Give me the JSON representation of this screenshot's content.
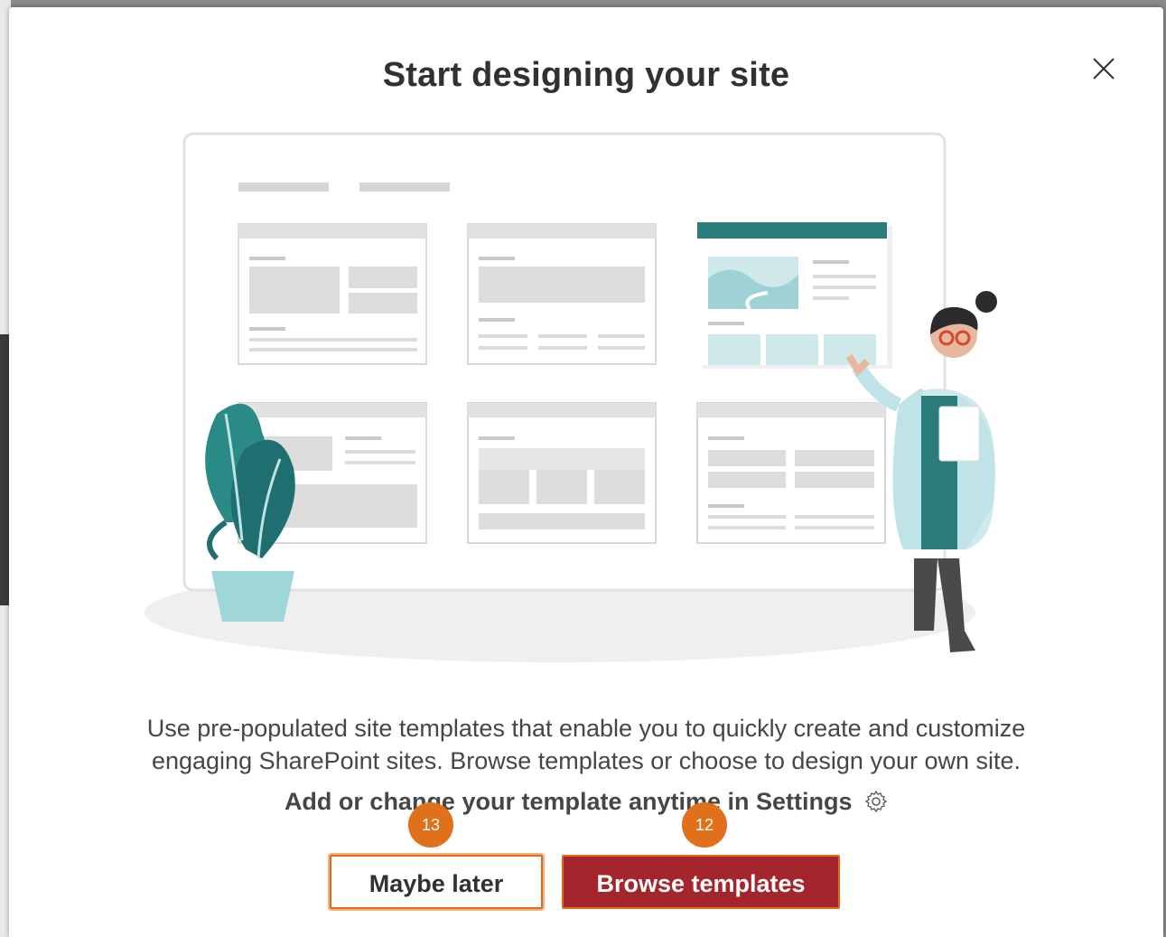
{
  "dialog": {
    "title": "Start designing your site",
    "close_icon": "close-icon",
    "description_line1": "Use pre-populated site templates that enable you to quickly create and customize",
    "description_line2": "engaging SharePoint sites. Browse templates or choose to design your own site.",
    "settings_text": "Add or change your template anytime in Settings",
    "settings_icon": "gear-icon",
    "buttons": {
      "maybe_later": "Maybe later",
      "browse_templates": "Browse templates"
    },
    "badges": {
      "maybe_later_step": "13",
      "browse_templates_step": "12"
    }
  },
  "colors": {
    "primary_button": "#a4262c",
    "badge": "#e0701c",
    "accent_teal": "#2a7d7a"
  }
}
